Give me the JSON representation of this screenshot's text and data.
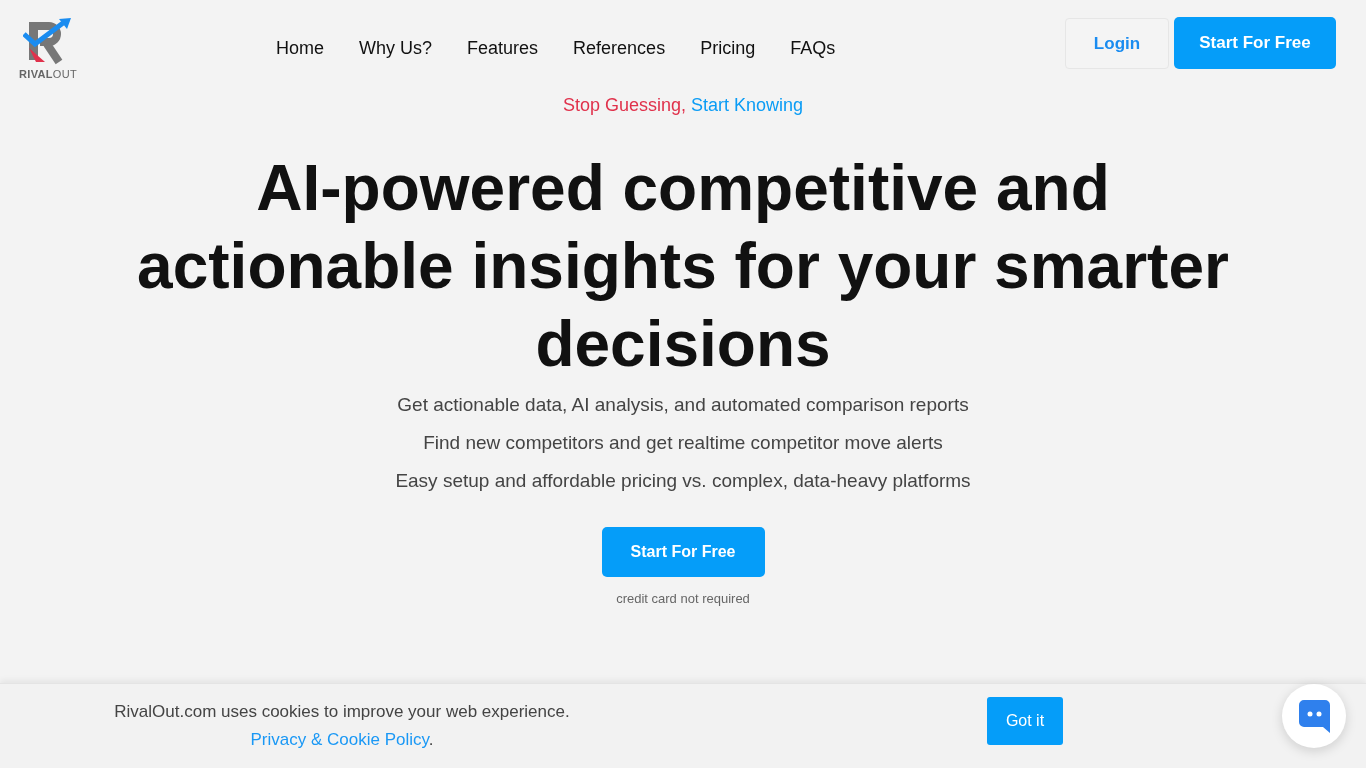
{
  "header": {
    "logo_text": "**RIVAL**OUT",
    "nav": [
      "Home",
      "Why Us?",
      "Features",
      "References",
      "Pricing",
      "FAQs"
    ],
    "login_button": "Login",
    "signup_button": "Start For Free"
  },
  "hero": {
    "tagline": [
      {
        "text": "Stop Guessing,",
        "color": "#e0314b"
      },
      {
        "text": "Start Knowing",
        "color": "#0a9cf5"
      }
    ],
    "title": "AI-powered competitive and actionable insights for your smarter decisions",
    "points": [
      "Get actionable data, AI analysis, and automated comparison reports",
      "Find new competitors and get realtime competitor move alerts",
      "Easy setup and affordable pricing vs. complex, data-heavy platforms"
    ],
    "cta_button": "Start For Free",
    "cta_note": "credit card not required"
  },
  "cookie_banner": {
    "message": "RivalOut.com uses cookies to improve your web experience.",
    "policy_link": "Privacy & Cookie Policy",
    "after_link": ".",
    "button": "Got it"
  }
}
